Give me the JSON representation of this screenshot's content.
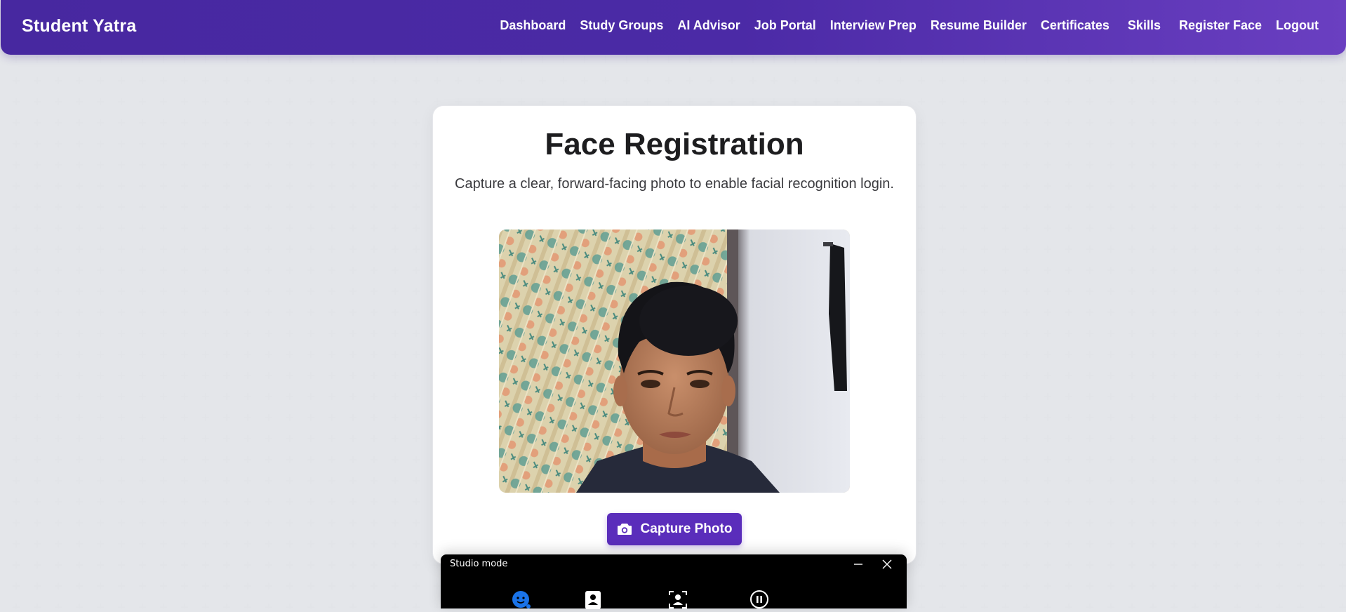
{
  "navbar": {
    "brand": "Student Yatra",
    "links": [
      "Dashboard",
      "Study Groups",
      "AI Advisor",
      "Job Portal",
      "Interview Prep",
      "Resume Builder",
      "Certificates",
      "Skills",
      "Register Face",
      "Logout"
    ]
  },
  "card": {
    "title": "Face Registration",
    "subtitle": "Capture a clear, forward-facing photo to enable facial recognition login.",
    "capture_label": "Capture Photo",
    "capture_icon": "camera-icon"
  },
  "studio": {
    "title": "Studio mode",
    "controls": [
      "minimize-icon",
      "close-icon"
    ],
    "icons": [
      "face-effect-icon",
      "portrait-icon",
      "automatic-framing-icon",
      "pause-icon"
    ]
  },
  "colors": {
    "nav_start": "#4728a0",
    "nav_end": "#6a3fc1",
    "accent": "#5a2dbb",
    "studio_icon_blue": "#1a73e8"
  }
}
